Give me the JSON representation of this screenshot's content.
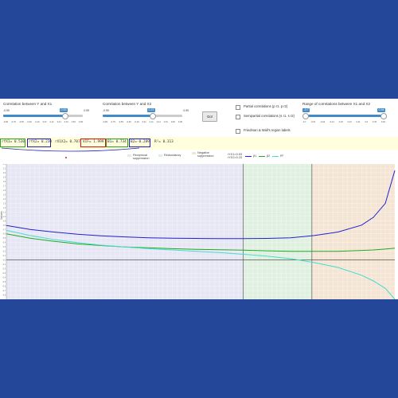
{
  "sliders": [
    {
      "title": "Correlation between Y and X1",
      "min": "-0.99",
      "max": "0.99",
      "value": "0.53",
      "fraction": 0.77,
      "ticks": [
        "-0.99",
        "-0.79",
        "-0.59",
        "-0.39",
        "-0.19",
        "0.01",
        "0.21",
        "0.41",
        "0.61",
        "0.81",
        "0.99"
      ]
    },
    {
      "title": "Correlation between Y and X2",
      "min": "-0.99",
      "max": "0.99",
      "value": "0.23",
      "fraction": 0.62,
      "ticks": [
        "-0.99",
        "-0.79",
        "-0.59",
        "-0.39",
        "-0.19",
        "0.01",
        "0.21",
        "0.41",
        "0.61",
        "0.81",
        "0.99"
      ]
    }
  ],
  "range_slider": {
    "title": "Range of correlations between X1 and X2",
    "from": "-0.7",
    "to": "0.94",
    "ticks": [
      "-0.7",
      "-0.51",
      "-0.33",
      "-0.14",
      "0.04",
      "0.23",
      "0.41",
      "0.6",
      "0.78",
      "0.94"
    ]
  },
  "go_button": "Go!",
  "options": [
    "Partial correlations (p r1. p r2)",
    "Semipartial correlations (s r1. s r2)",
    "Friedman & Wall's region labels"
  ],
  "stats": {
    "ryx1": "rYX1= 0.530",
    "ryx2": "rYX2= 0.230",
    "rx1x2": "rX1X2= 0.707",
    "vif": "VIF= 1.999",
    "b1": "B1= 0.734",
    "b2": "B2=-0.289",
    "r2": "R²= 0.313"
  },
  "legend": {
    "reciprocal": "Reciprocal suppression",
    "redundancy": "Redundancy",
    "negative": "Negative suppression",
    "rx1_label": "rYX1=0.53",
    "rx2_label": "rYX2=0.23",
    "series": [
      "β1",
      "β2",
      "R²"
    ]
  },
  "colors": {
    "beta1": "#2222cc",
    "beta2": "#22aa22",
    "r2": "#44ddcc",
    "region_reciprocal": "#e6e6f4",
    "region_redundancy": "#e0f0e0",
    "region_negative": "#f4e4d4",
    "highlight_green": "#2ca02c",
    "highlight_blue": "#1f1fbf",
    "highlight_red": "#dd1111"
  },
  "y_axis_label": "Values",
  "chart_data": {
    "type": "line",
    "x_range": [
      -0.7,
      0.94
    ],
    "y_range": [
      -0.9,
      2.2
    ],
    "region_bounds": [
      0.3,
      0.59
    ],
    "series": [
      {
        "name": "β1",
        "x": [
          -0.7,
          -0.6,
          -0.5,
          -0.4,
          -0.3,
          -0.2,
          -0.1,
          0,
          0.1,
          0.2,
          0.3,
          0.4,
          0.5,
          0.6,
          0.7,
          0.8,
          0.85,
          0.9,
          0.94
        ],
        "values": [
          0.79,
          0.7,
          0.64,
          0.59,
          0.555,
          0.53,
          0.51,
          0.5,
          0.495,
          0.49,
          0.49,
          0.495,
          0.51,
          0.56,
          0.64,
          0.8,
          0.98,
          1.3,
          2.05
        ]
      },
      {
        "name": "β2",
        "x": [
          -0.7,
          -0.6,
          -0.5,
          -0.4,
          -0.3,
          -0.2,
          -0.1,
          0,
          0.1,
          0.2,
          0.3,
          0.4,
          0.5,
          0.6,
          0.7,
          0.8,
          0.85,
          0.9,
          0.94
        ],
        "values": [
          0.6,
          0.5,
          0.43,
          0.37,
          0.33,
          0.3,
          0.28,
          0.26,
          0.245,
          0.235,
          0.225,
          0.21,
          0.2,
          0.2,
          0.2,
          0.22,
          0.23,
          0.25,
          0.27
        ]
      },
      {
        "name": "R²",
        "x": [
          -0.7,
          -0.6,
          -0.5,
          -0.4,
          -0.3,
          -0.2,
          -0.1,
          0,
          0.1,
          0.2,
          0.3,
          0.4,
          0.5,
          0.6,
          0.7,
          0.8,
          0.85,
          0.9,
          0.94
        ],
        "values": [
          0.68,
          0.56,
          0.47,
          0.4,
          0.34,
          0.3,
          0.26,
          0.23,
          0.2,
          0.17,
          0.13,
          0.09,
          0.03,
          -0.06,
          -0.17,
          -0.35,
          -0.48,
          -0.65,
          -0.9
        ]
      }
    ]
  }
}
